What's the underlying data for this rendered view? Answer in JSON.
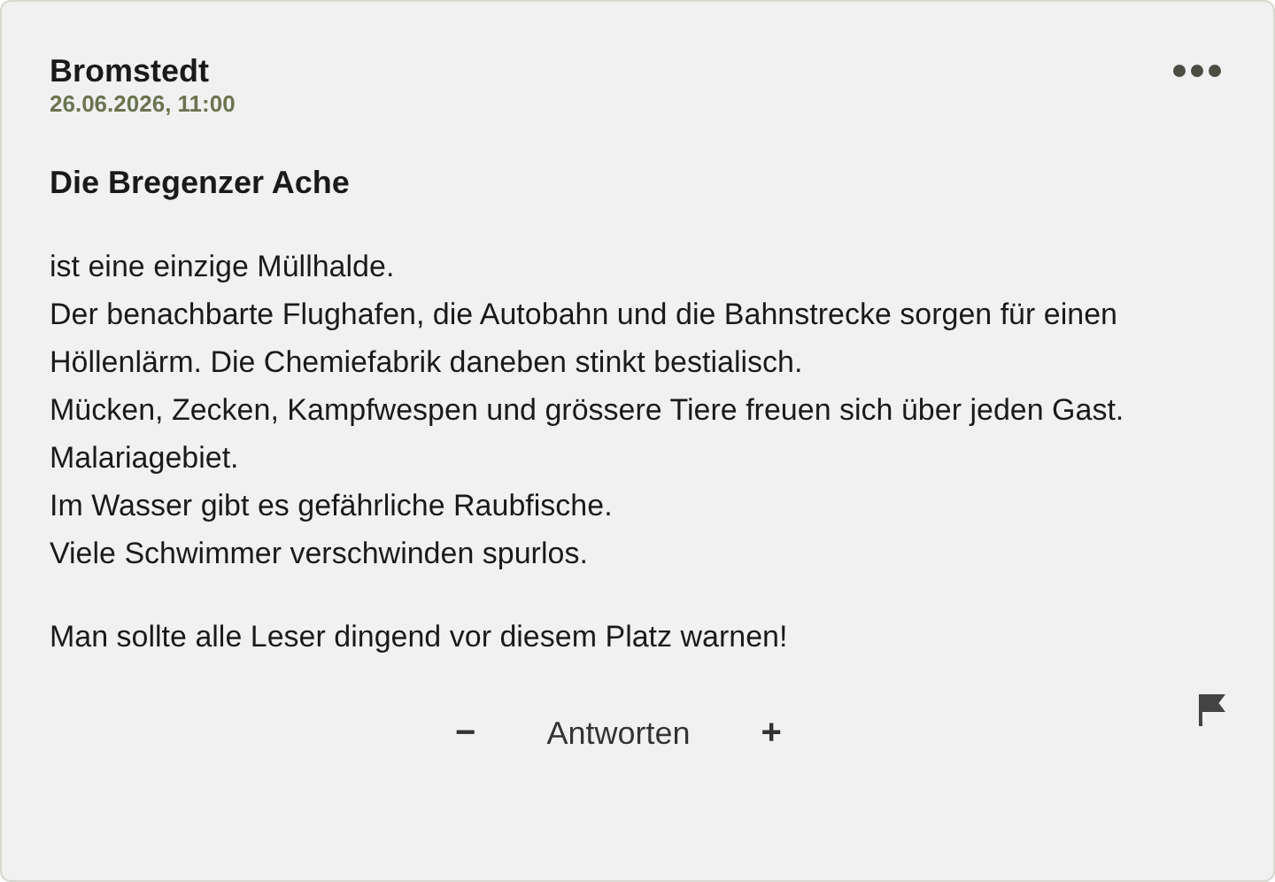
{
  "post": {
    "author": "Bromstedt",
    "date": "26.06.2026, 11:00",
    "title": "Die Bregenzer Ache",
    "body_lines": [
      "ist eine einzige Müllhalde.",
      "Der benachbarte Flughafen, die Autobahn und die Bahnstrecke sorgen für einen Höllenlärm. Die Chemiefabrik daneben stinkt bestialisch.",
      "Mücken, Zecken, Kampfwespen und grössere Tiere freuen sich über jeden Gast. Malariagebiet.",
      "Im Wasser gibt es gefährliche Raubfische.",
      "Viele Schwimmer verschwinden spurlos."
    ],
    "closing": "Man sollte alle Leser dingend vor diesem Platz warnen!",
    "actions": {
      "minus": "−",
      "reply": "Antworten",
      "plus": "+"
    }
  }
}
